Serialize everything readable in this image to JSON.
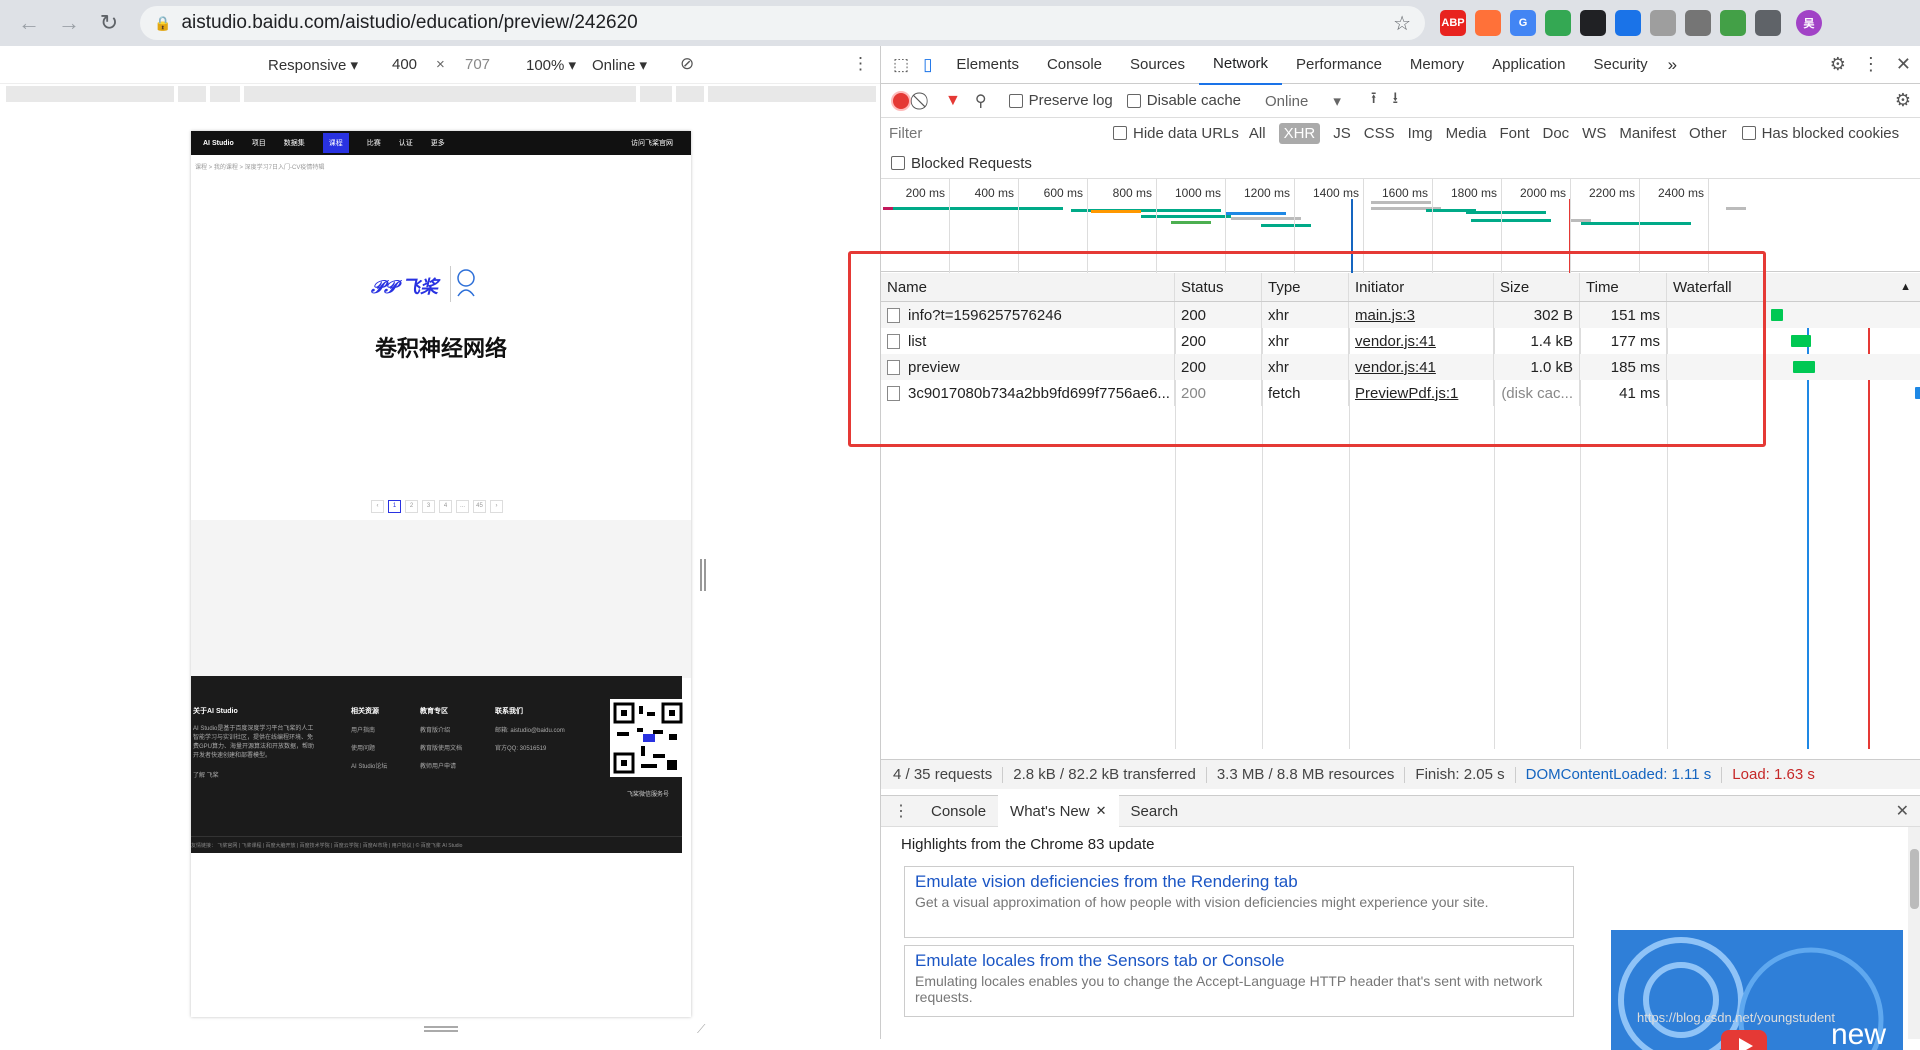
{
  "browser": {
    "url": "aistudio.baidu.com/aistudio/education/preview/242620",
    "extensions": [
      {
        "name": "abp-icon",
        "label": "ABP",
        "color": "#e8231f"
      },
      {
        "name": "firefox-icon",
        "label": "",
        "color": "#ff7139"
      },
      {
        "name": "translate-icon",
        "label": "G",
        "color": "#4285f4"
      },
      {
        "name": "chrome-icon",
        "label": "",
        "color": "#34a853"
      },
      {
        "name": "cursor-icon",
        "label": "",
        "color": "#202124"
      },
      {
        "name": "vpn-icon",
        "label": "",
        "color": "#1a73e8"
      },
      {
        "name": "check-icon",
        "label": "",
        "color": "#9e9e9e"
      },
      {
        "name": "reader-icon",
        "label": "",
        "color": "#757575"
      },
      {
        "name": "android-icon",
        "label": "",
        "color": "#43a047"
      },
      {
        "name": "puzzle-icon",
        "label": "",
        "color": "#5f6368"
      },
      {
        "name": "profile-avatar",
        "label": "吴",
        "color": "#a142c6"
      }
    ]
  },
  "device_toolbar": {
    "mode": "Responsive",
    "width": "400",
    "height": "707",
    "zoom": "100%",
    "throttle": "Online"
  },
  "page": {
    "nav": [
      "AI Studio",
      "项目",
      "数据集",
      "课程",
      "比赛",
      "认证",
      "更多"
    ],
    "nav_right": "访问飞桨官网",
    "breadcrumb": "课程 > 我的课程 > 深度学习7日入门-CV疫情特辑",
    "logo": "飞桨",
    "title": "卷积神经网络",
    "pager": [
      "‹",
      "1",
      "2",
      "3",
      "4",
      "...",
      "45",
      "›"
    ],
    "footer": {
      "col1_title": "关于AI Studio",
      "col1_text": "AI Studio是基于百度深度学习平台飞桨的人工智能学习与实训社区，提供在线编程环境、免费GPU算力、海量开源算法和开放数据，帮助开发者快速创建和部署模型。",
      "col1_more": "了解 飞桨",
      "col2_title": "相关资源",
      "col2_links": [
        "用户指南",
        "使用问题",
        "AI Studio论坛"
      ],
      "col3_title": "教育专区",
      "col3_links": [
        "教育版介绍",
        "教育版使用文档",
        "教师用户申请"
      ],
      "col4_title": "联系我们",
      "col4_lines": [
        "邮箱: aistudio@baidu.com",
        "官方QQ: 30516519"
      ],
      "qr_caption": "飞桨微信服务号",
      "links": "友情链接： 飞桨官网 | 飞桨课程 | 百度大脑开放 | 百度技术学院 | 百度云学院 | 百度AI市场 | 用户协议 | © 百度飞桨 AI Studio"
    }
  },
  "devtools": {
    "tabs": [
      "Elements",
      "Console",
      "Sources",
      "Network",
      "Performance",
      "Memory",
      "Application",
      "Security"
    ],
    "active_tab": "Network",
    "more_tabs": "»",
    "toolbar": {
      "preserve_log": "Preserve log",
      "disable_cache": "Disable cache",
      "throttle": "Online"
    },
    "filter": {
      "placeholder": "Filter",
      "hide_data_urls": "Hide data URLs",
      "types": [
        "All",
        "XHR",
        "JS",
        "CSS",
        "Img",
        "Media",
        "Font",
        "Doc",
        "WS",
        "Manifest",
        "Other"
      ],
      "active_type": "XHR",
      "has_blocked_cookies": "Has blocked cookies",
      "blocked_requests": "Blocked Requests"
    },
    "overview_ticks": [
      "200 ms",
      "400 ms",
      "600 ms",
      "800 ms",
      "1000 ms",
      "1200 ms",
      "1400 ms",
      "1600 ms",
      "1800 ms",
      "2000 ms",
      "2200 ms",
      "2400 ms"
    ],
    "columns": [
      "Name",
      "Status",
      "Type",
      "Initiator",
      "Size",
      "Time",
      "Waterfall"
    ],
    "requests": [
      {
        "name": "info?t=1596257576246",
        "status": "200",
        "type": "xhr",
        "initiator": "main.js:3",
        "size": "302 B",
        "time": "151 ms"
      },
      {
        "name": "list",
        "status": "200",
        "type": "xhr",
        "initiator": "vendor.js:41",
        "size": "1.4 kB",
        "time": "177 ms"
      },
      {
        "name": "preview",
        "status": "200",
        "type": "xhr",
        "initiator": "vendor.js:41",
        "size": "1.0 kB",
        "time": "185 ms"
      },
      {
        "name": "3c9017080b734a2bb9fd699f7756ae6...",
        "status": "200",
        "type": "fetch",
        "initiator": "PreviewPdf.js:1",
        "size": "(disk cac...",
        "time": "41 ms"
      }
    ],
    "summary": {
      "requests": "4 / 35 requests",
      "transferred": "2.8 kB / 82.2 kB transferred",
      "resources": "3.3 MB / 8.8 MB resources",
      "finish": "Finish: 2.05 s",
      "dom_loaded": "DOMContentLoaded: 1.11 s",
      "load": "Load: 1.63 s"
    },
    "drawer": {
      "tabs": [
        "Console",
        "What's New",
        "Search"
      ],
      "active_tab": "What's New",
      "highlight": "Highlights from the Chrome 83 update",
      "cards": [
        {
          "title": "Emulate vision deficiencies from the Rendering tab",
          "desc": "Get a visual approximation of how people with vision deficiencies might experience your site."
        },
        {
          "title": "Emulate locales from the Sensors tab or Console",
          "desc": "Emulating locales enables you to change the Accept-Language HTTP header that's sent with network requests."
        }
      ],
      "promo_text": "new"
    }
  },
  "watermark": "https://blog.csdn.net/youngstudent"
}
